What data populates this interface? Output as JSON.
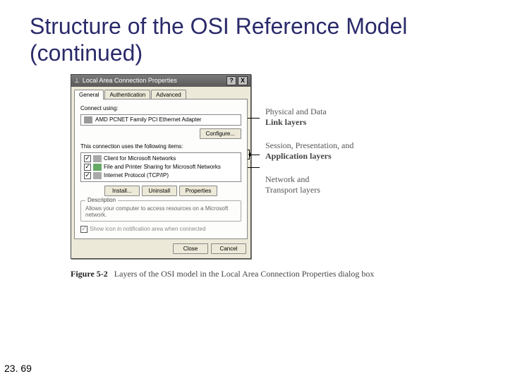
{
  "slide": {
    "title": "Structure of the OSI Reference Model (continued)",
    "page_number": "23. 69"
  },
  "dialog": {
    "title": "Local Area Connection Properties",
    "help_btn": "?",
    "close_btn": "X",
    "tabs": {
      "general": "General",
      "auth": "Authentication",
      "advanced": "Advanced"
    },
    "connect_using_label": "Connect using:",
    "adapter": "AMD PCNET Family PCI Ethernet Adapter",
    "configure_btn": "Configure...",
    "items_label": "This connection uses the following items:",
    "items": [
      {
        "label": "Client for Microsoft Networks"
      },
      {
        "label": "File and Printer Sharing for Microsoft Networks"
      },
      {
        "label": "Internet Protocol (TCP/IP)"
      }
    ],
    "install_btn": "Install...",
    "uninstall_btn": "Uninstall",
    "properties_btn": "Properties",
    "desc_legend": "Description",
    "desc_text": "Allows your computer to access resources on a Microsoft network.",
    "show_icon": "Show icon in notification area when connected",
    "close_btn2": "Close",
    "cancel_btn": "Cancel"
  },
  "callouts": {
    "c1": {
      "light": "Physical and Data",
      "bold": "Link layers"
    },
    "c2": {
      "light": "Session, Presentation, and",
      "bold": "Application layers"
    },
    "c3": {
      "light": "Network and",
      "light2": "Transport layers"
    }
  },
  "figure": {
    "number": "Figure 5-2",
    "caption": "Layers of the OSI model in the Local Area Connection Properties dialog box"
  }
}
